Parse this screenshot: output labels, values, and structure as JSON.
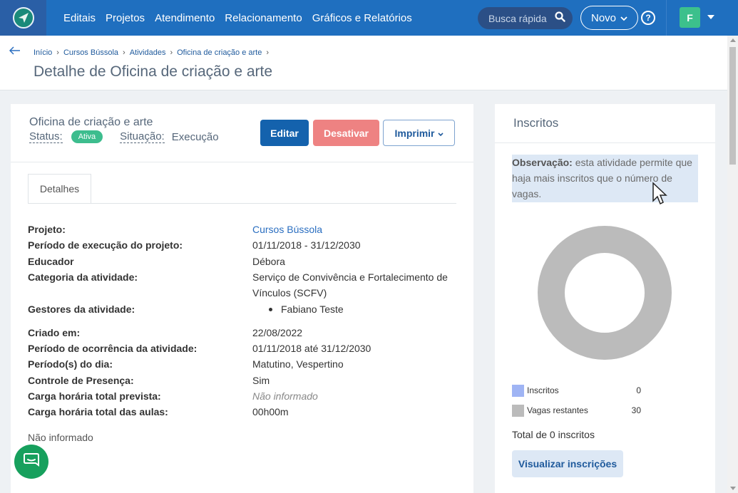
{
  "nav": {
    "items": [
      "Editais",
      "Projetos",
      "Atendimento",
      "Relacionamento",
      "Gráficos e Relatórios"
    ],
    "search_placeholder": "Busca rápida",
    "novo_label": "Novo",
    "help_label": "?",
    "avatar_initial": "F"
  },
  "breadcrumb": [
    "Início",
    "Cursos Bússola",
    "Atividades",
    "Oficina de criação e arte"
  ],
  "page_title": "Detalhe de Oficina de criação e arte",
  "activity": {
    "name": "Oficina de criação e arte",
    "status_label": "Status:",
    "status_value": "Ativa",
    "situacao_label": "Situação:",
    "situacao_value": "Execução"
  },
  "buttons": {
    "edit": "Editar",
    "deactivate": "Desativar",
    "print": "Imprimir"
  },
  "tab": "Detalhes",
  "details": [
    {
      "label": "Projeto:",
      "value": "Cursos Bússola",
      "style": "link"
    },
    {
      "label": "Período de execução do projeto:",
      "value": "01/11/2018 - 31/12/2030"
    },
    {
      "label": "Educador",
      "value": "Débora"
    },
    {
      "label": "Categoria da atividade:",
      "value": "Serviço de Convivência e Fortalecimento de Vínculos (SCFV)"
    },
    {
      "label": "Gestores da atividade:",
      "value": "Fabiano Teste"
    },
    {
      "label": "Criado em:",
      "value": "22/08/2022"
    },
    {
      "label": "Período de ocorrência da atividade:",
      "value": "01/11/2018 até 31/12/2030"
    },
    {
      "label": "Período(s) do dia:",
      "value": "Matutino, Vespertino"
    },
    {
      "label": "Controle de Presença:",
      "value": "Sim"
    },
    {
      "label": "Carga horária total prevista:",
      "value": "Não informado",
      "style": "italic"
    },
    {
      "label": "Carga horária total das aulas:",
      "value": "00h00m"
    }
  ],
  "footer_note": "Não informado",
  "inscritos": {
    "title": "Inscritos",
    "obs_label": "Observação:",
    "obs_text": " esta atividade permite que haja mais inscritos que o número de vagas.",
    "legend": [
      {
        "label": "Inscritos",
        "value": "0",
        "color": "#9fb4f4"
      },
      {
        "label": "Vagas restantes",
        "value": "30",
        "color": "#bbbbbb"
      }
    ],
    "total": "Total de 0 inscritos",
    "view_button": "Visualizar inscrições"
  },
  "chart_data": {
    "type": "pie",
    "categories": [
      "Inscritos",
      "Vagas restantes"
    ],
    "values": [
      0,
      30
    ],
    "colors": [
      "#9fb4f4",
      "#bbbbbb"
    ]
  },
  "colors": {
    "topbar": "#1f6fbf",
    "primary": "#1462ad",
    "danger": "#ee8282",
    "success": "#3dbd8e"
  }
}
